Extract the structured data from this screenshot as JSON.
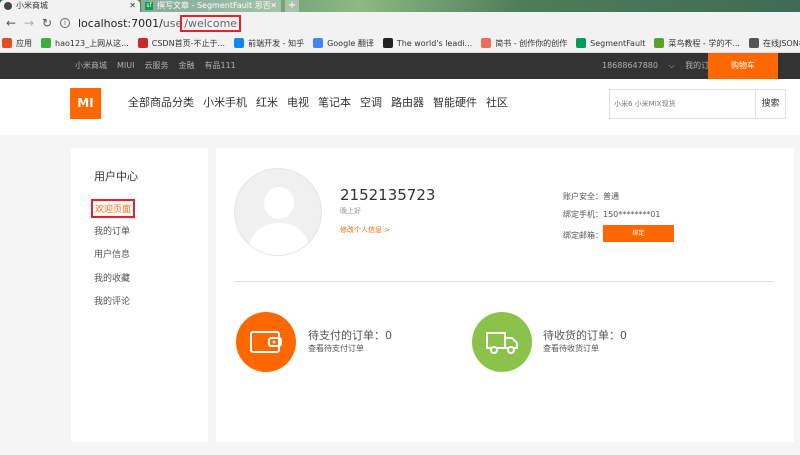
{
  "browser": {
    "active_tab": "小米商城",
    "other_tab": "撰写文章 - SegmentFault 思否",
    "url_host": "localhost:7001/",
    "url_path_pre": "use",
    "url_path_highlight": "/welcome",
    "bookmarks": [
      {
        "label": "应用",
        "color": "#e34c26",
        "icon": "apps-icon"
      },
      {
        "label": "hao123_上网从这...",
        "color": "#3cae3c",
        "icon": "hao123-icon"
      },
      {
        "label": "CSDN首页-不止于...",
        "color": "#c8282a",
        "icon": "csdn-icon"
      },
      {
        "label": "前端开发 - 知乎",
        "color": "#0f88eb",
        "icon": "zhihu-icon"
      },
      {
        "label": "Google 翻译",
        "color": "#4285f4",
        "icon": "google-icon"
      },
      {
        "label": "The world's leadi...",
        "color": "#222",
        "icon": "github-icon"
      },
      {
        "label": "简书 - 创作你的创作",
        "color": "#ea6f5a",
        "icon": "jianshu-icon"
      },
      {
        "label": "SegmentFault",
        "color": "#009a61",
        "icon": "segmentfault-icon"
      },
      {
        "label": "菜鸟教程 - 学的不...",
        "color": "#5aa02c",
        "icon": "runoob-icon"
      },
      {
        "label": "在线JSON校验格式...",
        "color": "#555",
        "icon": "json-icon"
      }
    ]
  },
  "site_top": {
    "links": [
      "小米商城",
      "MIUI",
      "云服务",
      "金融",
      "有品111"
    ],
    "phone": "18688647880",
    "orders": "我的订单",
    "cart": "购物车"
  },
  "header": {
    "logo": "MI",
    "nav": [
      "全部商品分类",
      "小米手机",
      "红米",
      "电视",
      "笔记本",
      "空调",
      "路由器",
      "智能硬件",
      "社区"
    ],
    "search_placeholder": "小米6 小米MIX现货",
    "search_button": "搜索"
  },
  "sidebar": {
    "title": "用户中心",
    "items": [
      "欢迎页面",
      "我的订单",
      "用户信息",
      "我的收藏",
      "我的评论"
    ]
  },
  "profile": {
    "username": "2152135723",
    "greeting": "晚上好",
    "edit_link": "修改个人信息 >",
    "security": "账户安全：普通",
    "phone": "绑定手机：150********01",
    "email_label": "绑定邮箱：",
    "bind_button": "绑定"
  },
  "orders": {
    "unpaid_title": "待支付的订单：0",
    "unpaid_link": "查看待支付订单",
    "unreceived_title": "待收货的订单：0",
    "unreceived_link": "查看待收货订单"
  },
  "colors": {
    "accent": "#ff6700",
    "green": "#8bc34a",
    "highlight": "#e8202a"
  }
}
